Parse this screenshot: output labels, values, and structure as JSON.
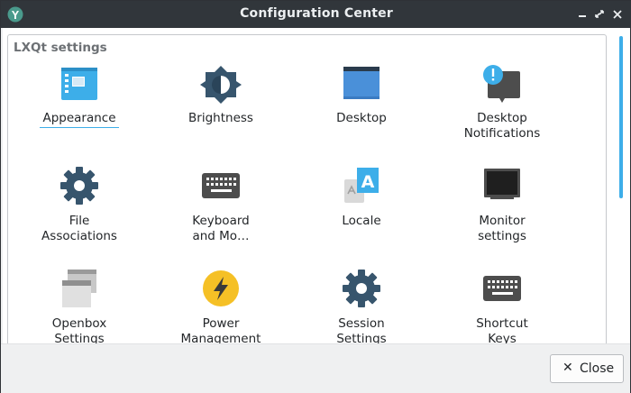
{
  "window": {
    "title": "Configuration Center",
    "controls": [
      "minimize",
      "maximize",
      "close"
    ]
  },
  "group": {
    "title": "LXQt settings"
  },
  "items": [
    {
      "label": "Appearance",
      "icon": "appearance-icon",
      "selected": true
    },
    {
      "label": "Brightness",
      "icon": "brightness-icon"
    },
    {
      "label": "Desktop",
      "icon": "desktop-icon"
    },
    {
      "label": "Desktop\nNotifications",
      "icon": "notification-icon"
    },
    {
      "label": "File\nAssociations",
      "icon": "gear-icon"
    },
    {
      "label": "Keyboard\nand Mo…",
      "icon": "keyboard-icon"
    },
    {
      "label": "Locale",
      "icon": "locale-icon"
    },
    {
      "label": "Monitor\nsettings",
      "icon": "monitor-icon"
    },
    {
      "label": "Openbox\nSettings",
      "icon": "openbox-windows-icon"
    },
    {
      "label": "Power\nManagement",
      "icon": "power-bolt-icon"
    },
    {
      "label": "Session\nSettings",
      "icon": "gear-icon"
    },
    {
      "label": "Shortcut\nKeys",
      "icon": "keyboard-icon"
    }
  ],
  "buttons": {
    "close_label": "Close"
  },
  "colors": {
    "titlebar": "#31363b",
    "accent": "#3daee9",
    "window_bg": "#eff0f1"
  }
}
